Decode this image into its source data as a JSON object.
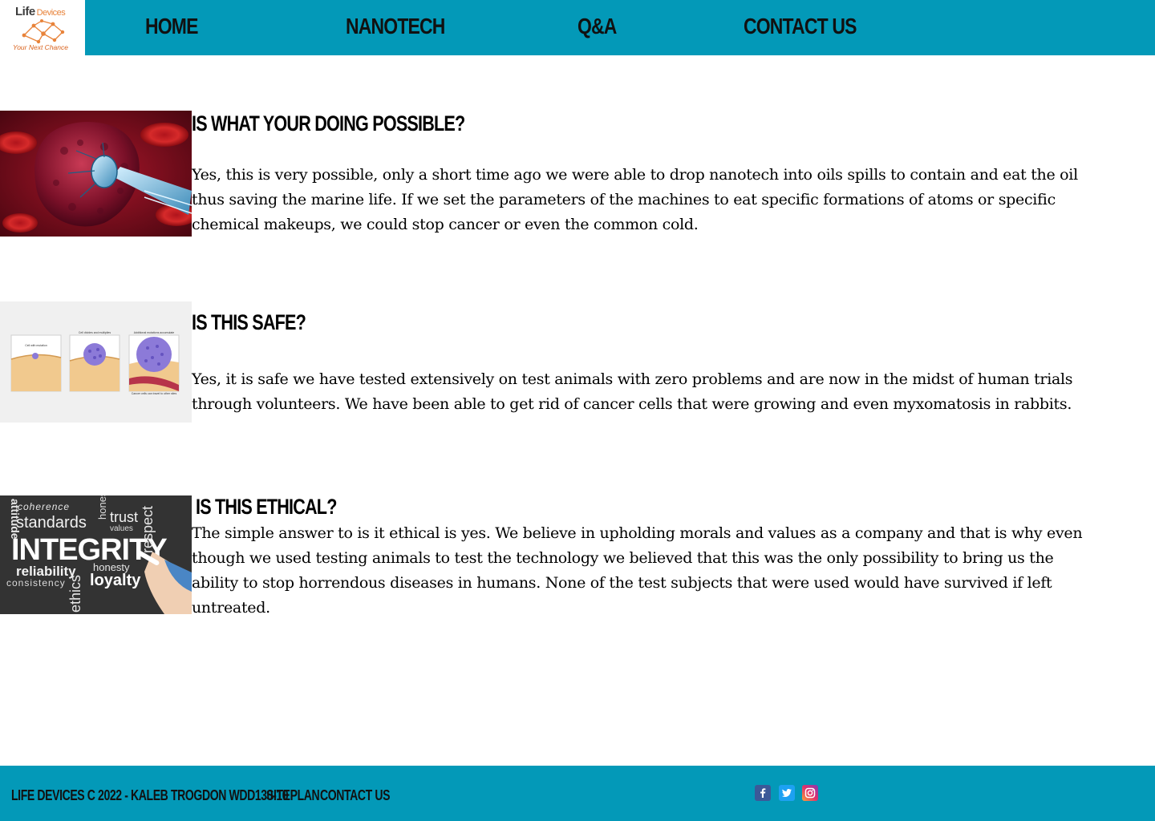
{
  "header": {
    "logo": {
      "title": "Life",
      "title_sub": "Devices",
      "tagline": "Your Next Chance"
    },
    "nav": [
      {
        "label": "Home"
      },
      {
        "label": "Nanotech"
      },
      {
        "label": "Q&A"
      },
      {
        "label": "Contact Us"
      }
    ]
  },
  "sections": [
    {
      "title": "Is what your doing possible?",
      "image_icon": "nanobot-on-blood-cell-image",
      "body": "Yes, this is very possible, only a short time ago we were able to drop nanotech into oils spills to contain and eat the oil thus saving the marine life. If we set the parameters of the machines to eat specific formations of atoms or specific chemical makeups, we could stop cancer or even the common cold."
    },
    {
      "title": "Is this safe?",
      "image_icon": "cancer-cell-growth-diagram",
      "image_captions": [
        "Cell with mutation",
        "Cell divides and multiplies",
        "Additional mutations accumulate",
        "Cancer cells can travel to other sites"
      ],
      "body": "Yes, it is safe we have tested extensively on test animals with zero problems and are now in the midst of human trials through volunteers. We have been able to get rid of cancer cells that were growing and even myxomatosis in rabbits."
    },
    {
      "title": "Is this ethical?",
      "image_icon": "integrity-chalkboard-image",
      "image_words": [
        "coherence",
        "standards",
        "trust",
        "values",
        "INTEGRITY",
        "attitude",
        "reliability",
        "honesty",
        "consistency",
        "loyalty",
        "ethics",
        "respect",
        "honest"
      ],
      "body": "The simple answer to is it ethical is yes. We believe in upholding morals and values as a company and that is why even though we used testing animals to test the technology we believed that this was the only possibility to bring us the ability to stop horrendous diseases in humans. None of the test subjects that were used would have survived if left untreated."
    }
  ],
  "footer": {
    "copyright": "Life Devices c 2022 - Kaleb Trogdon WDD130-10",
    "siteplan_label": "Siteplan",
    "contact_label": "Contact Us",
    "social": [
      "facebook-icon",
      "twitter-icon",
      "instagram-icon"
    ]
  },
  "colors": {
    "header_bg": "#0399b8",
    "footer_bg": "#0399b8",
    "text": "#000000",
    "logo_orange": "#e8833a"
  }
}
